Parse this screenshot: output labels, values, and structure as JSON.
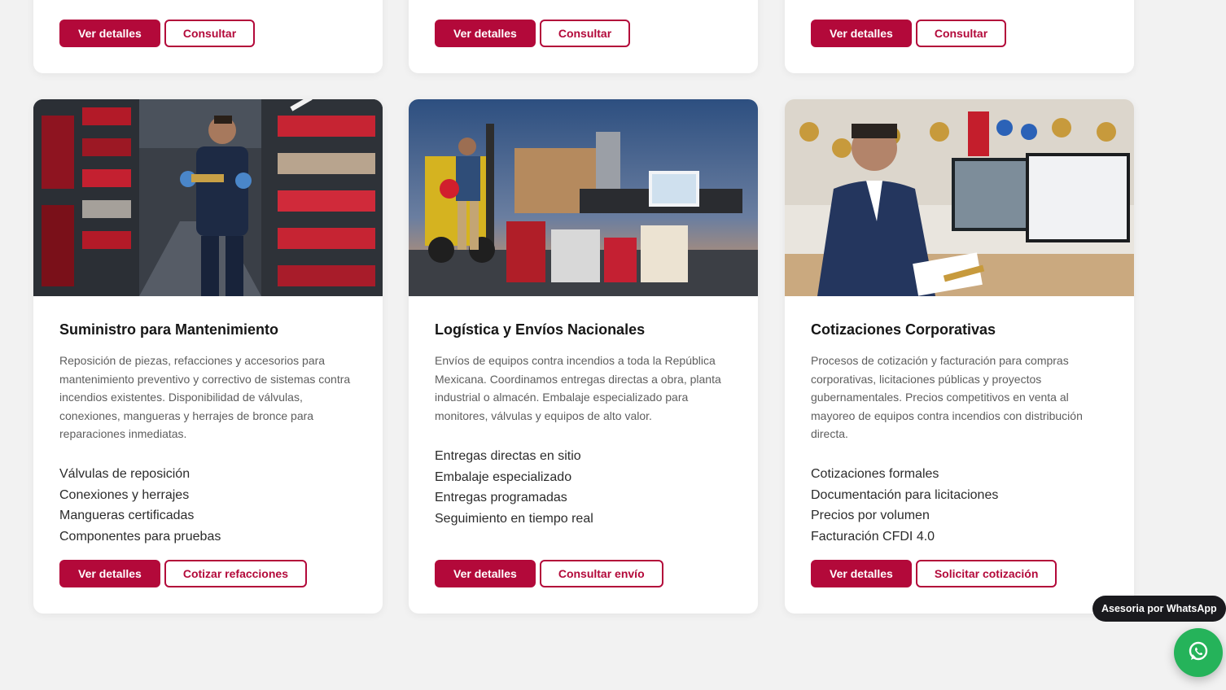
{
  "top_cards": [
    {
      "details_label": "Ver detalles",
      "action_label": "Consultar"
    },
    {
      "details_label": "Ver detalles",
      "action_label": "Consultar"
    },
    {
      "details_label": "Ver detalles",
      "action_label": "Consultar"
    }
  ],
  "cards": [
    {
      "title": "Suministro para Mantenimiento",
      "description": "Reposición de piezas, refacciones y accesorios para mantenimiento preventivo y correctivo de sistemas contra incendios existentes. Disponibilidad de válvulas, conexiones, mangueras y herrajes de bronce para reparaciones inmediatas.",
      "features": [
        "Válvulas de reposición",
        "Conexiones y herrajes",
        "Mangueras certificadas",
        "Componentes para pruebas"
      ],
      "details_label": "Ver detalles",
      "action_label": "Cotizar refacciones"
    },
    {
      "title": "Logística y Envíos Nacionales",
      "description": "Envíos de equipos contra incendios a toda la República Mexicana. Coordinamos entregas directas a obra, planta industrial o almacén. Embalaje especializado para monitores, válvulas y equipos de alto valor.",
      "features": [
        "Entregas directas en sitio",
        "Embalaje especializado",
        "Entregas programadas",
        "Seguimiento en tiempo real"
      ],
      "details_label": "Ver detalles",
      "action_label": "Consultar envío"
    },
    {
      "title": "Cotizaciones Corporativas",
      "description": "Procesos de cotización y facturación para compras corporativas, licitaciones públicas y proyectos gubernamentales. Precios competitivos en venta al mayoreo de equipos contra incendios con distribución directa.",
      "features": [
        "Cotizaciones formales",
        "Documentación para licitaciones",
        "Precios por volumen",
        "Facturación CFDI 4.0"
      ],
      "details_label": "Ver detalles",
      "action_label": "Solicitar cotización"
    }
  ],
  "whatsapp": {
    "label": "Asesoria por WhatsApp",
    "icon": "whatsapp-icon"
  },
  "colors": {
    "brand": "#b3093a",
    "background": "#f2f2f2",
    "whatsapp_green": "#25b35a"
  }
}
